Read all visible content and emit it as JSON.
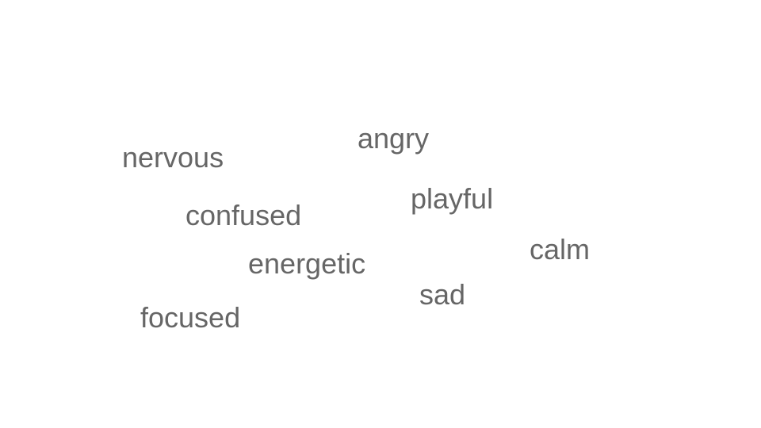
{
  "style": {
    "background_color": "#ffffff",
    "text_color": "#666666"
  },
  "words": [
    "angry",
    "nervous",
    "playful",
    "confused",
    "calm",
    "energetic",
    "sad",
    "focused"
  ]
}
